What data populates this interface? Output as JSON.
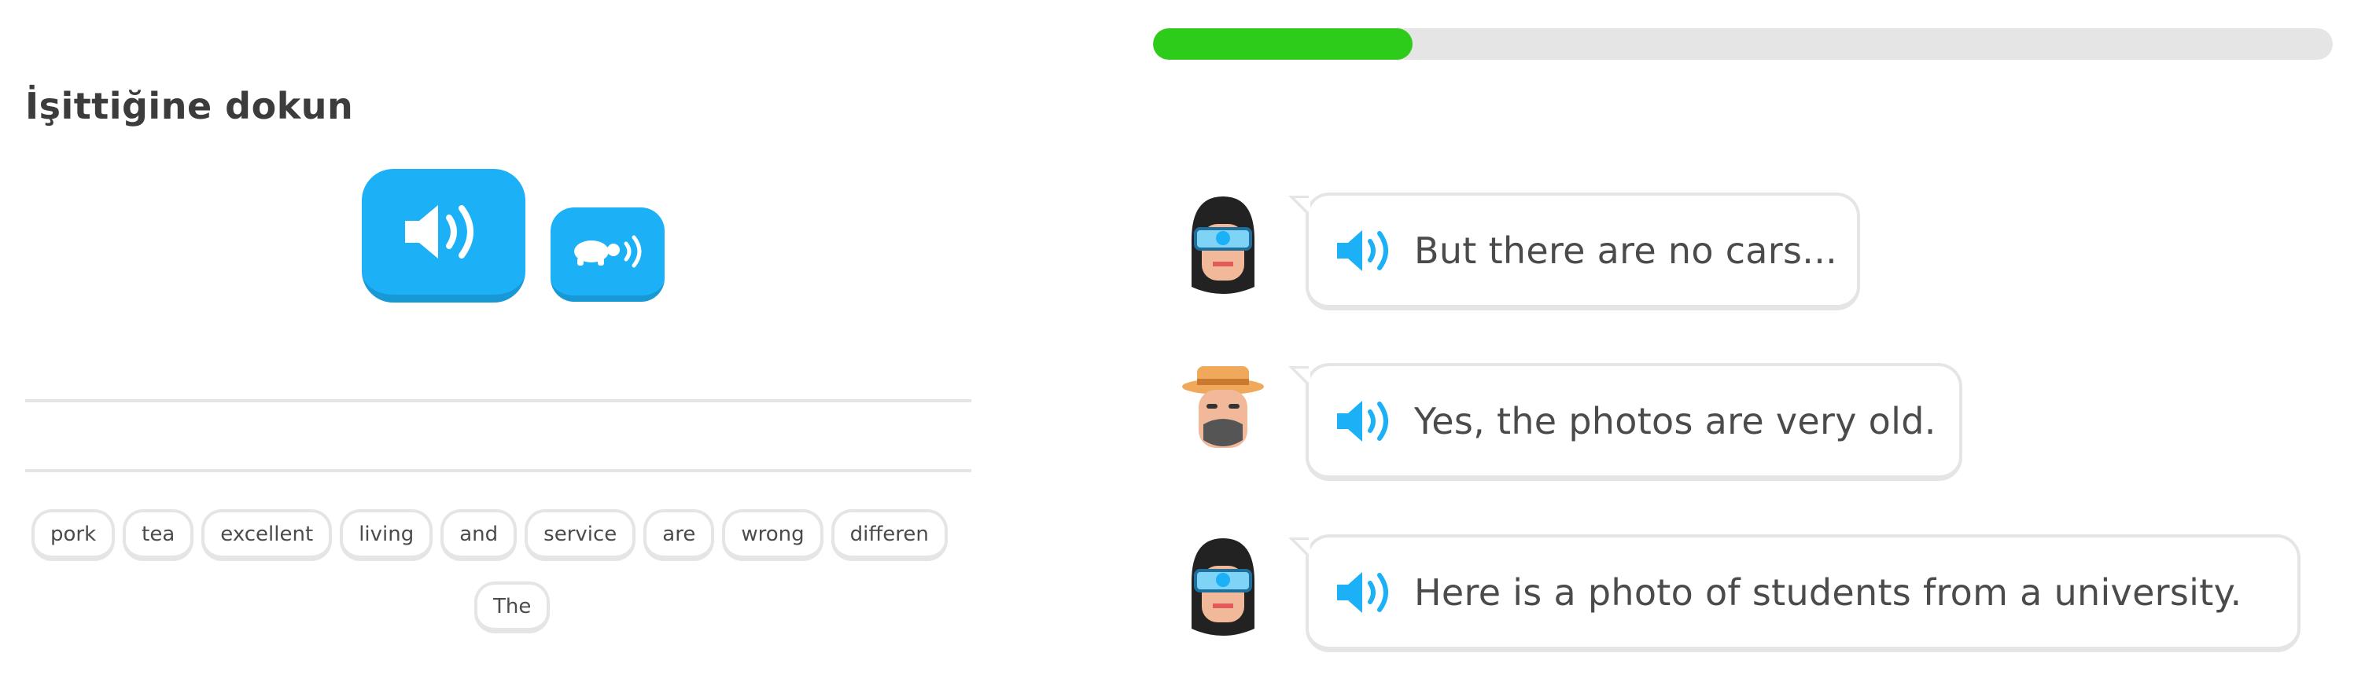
{
  "left": {
    "prompt": "İşittiğine dokun",
    "icons": {
      "play": "speaker-icon",
      "slow": "turtle-speaker-icon"
    },
    "word_bank": [
      "pork",
      "tea",
      "excellent",
      "living",
      "and",
      "service",
      "are",
      "wrong",
      "differen"
    ],
    "word_bank_row2": [
      "The"
    ]
  },
  "right": {
    "progress": 0.22,
    "colors": {
      "progress": "#2ecc1a",
      "accent": "#1cb0f6"
    },
    "messages": [
      {
        "speaker": "female-avatar",
        "text": "But there are no cars..."
      },
      {
        "speaker": "male-avatar",
        "text": "Yes, the photos are very old."
      },
      {
        "speaker": "female-avatar",
        "text": "Here is a photo of students from a university."
      }
    ]
  }
}
